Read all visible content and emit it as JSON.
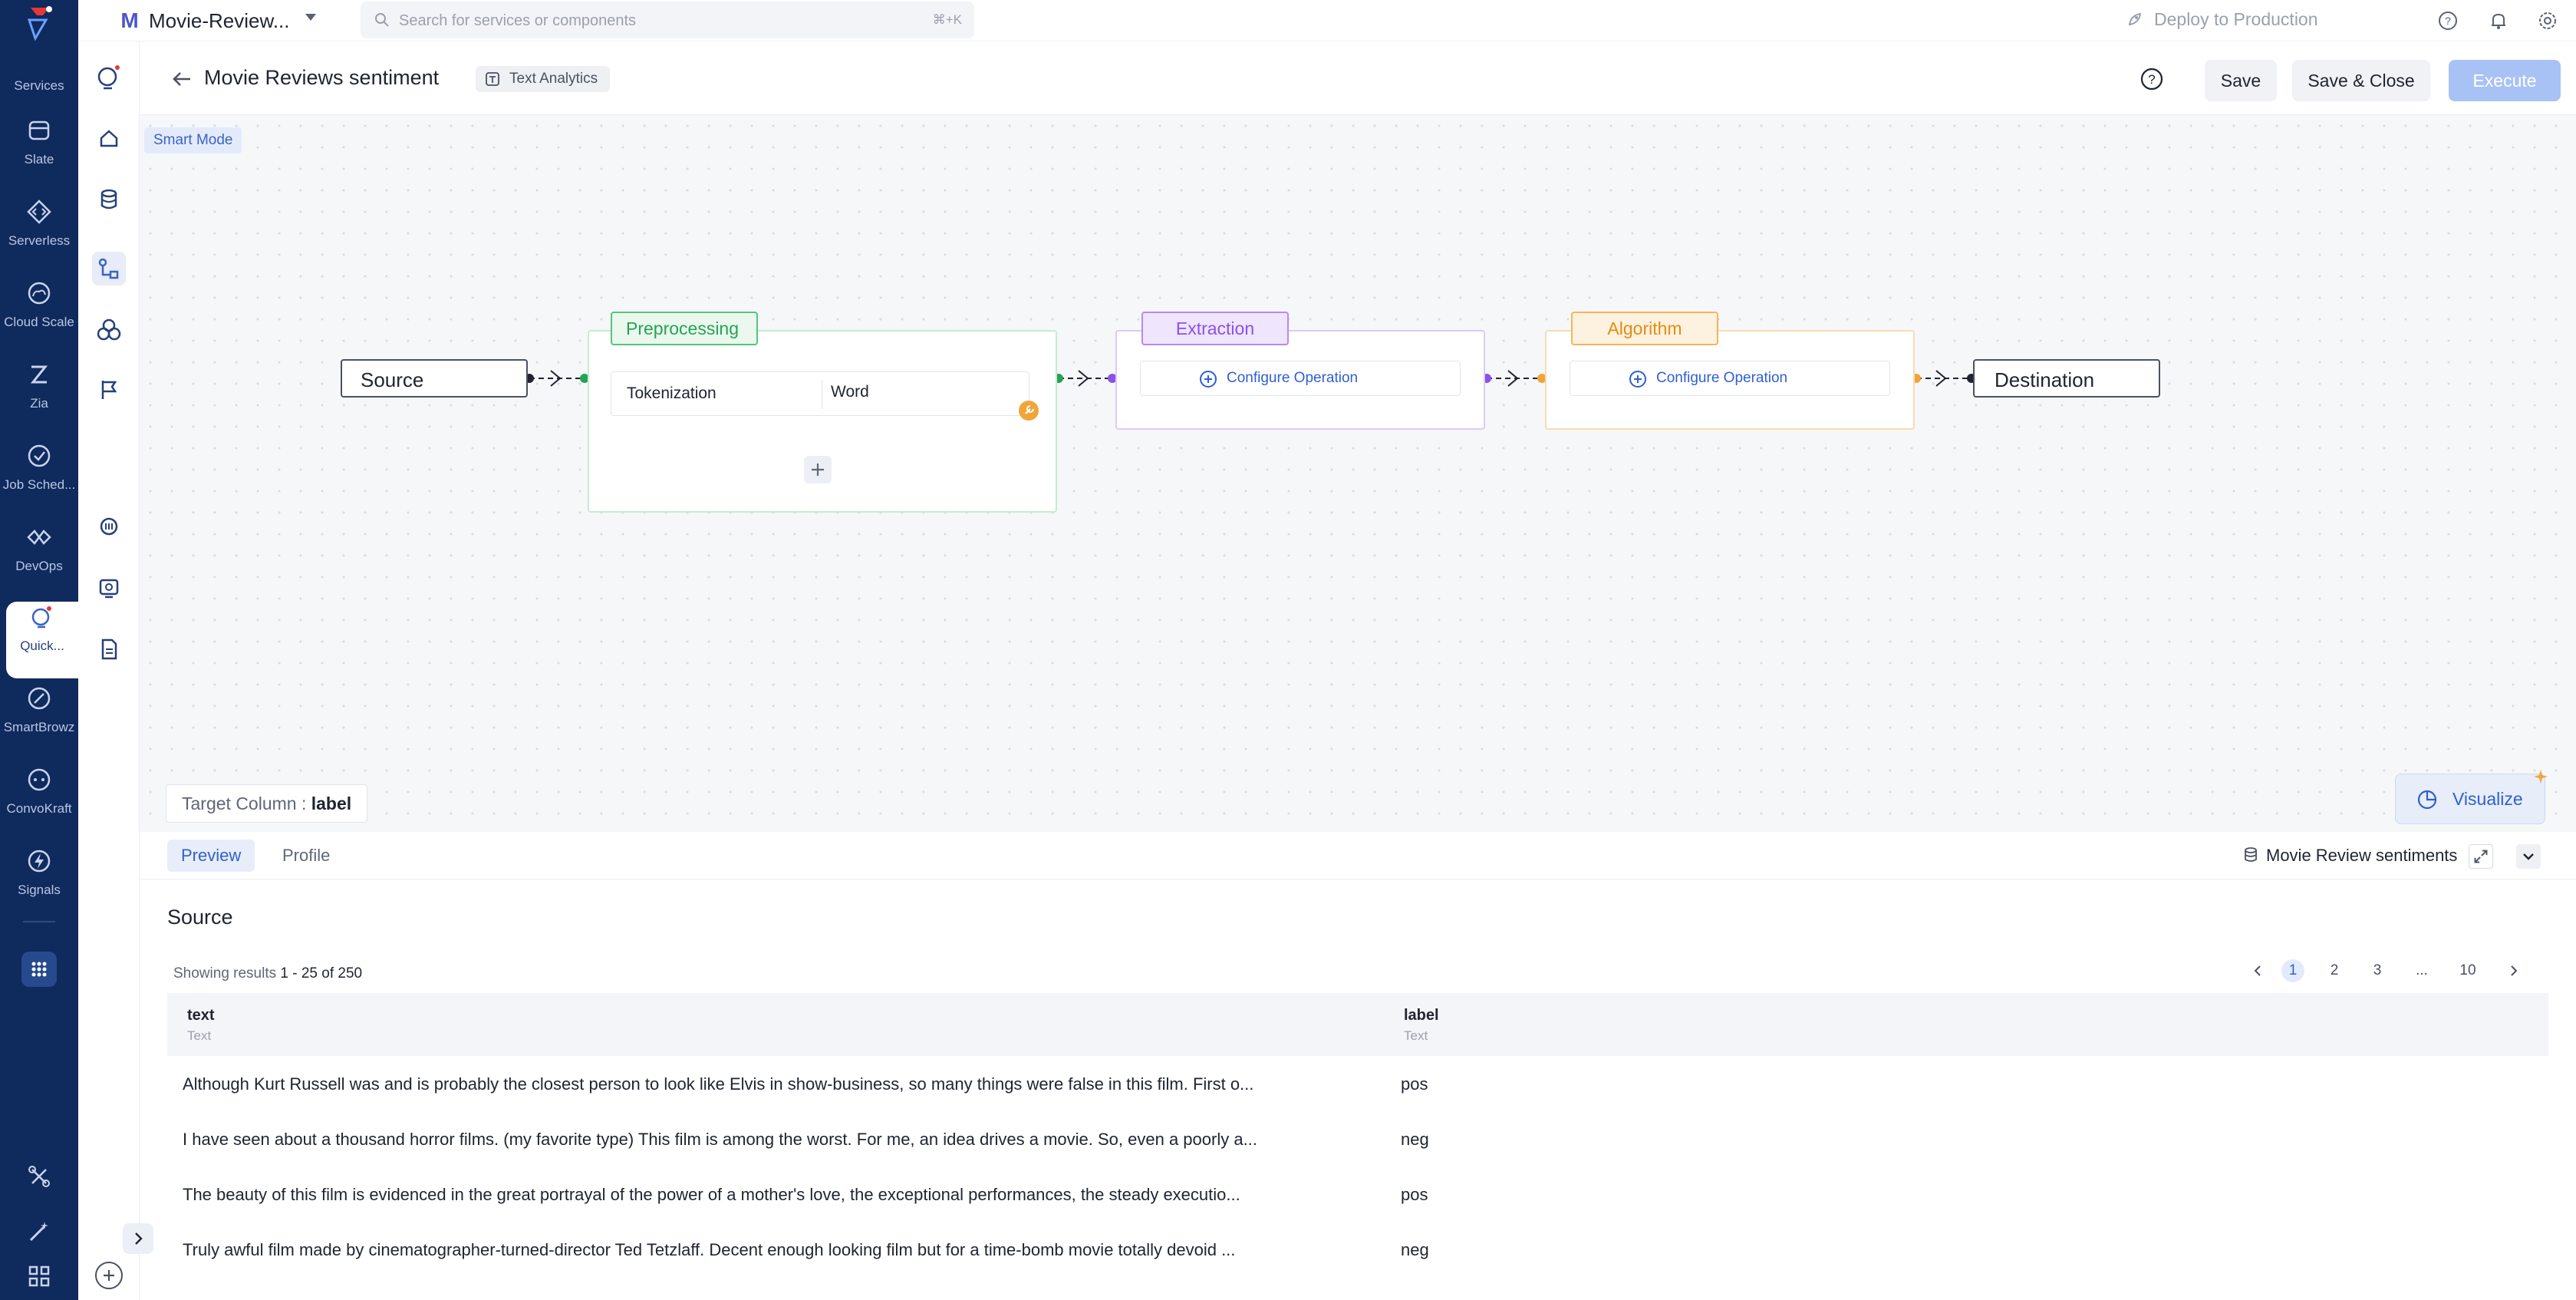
{
  "rail": {
    "top_label": "Services",
    "items": [
      {
        "label": "Slate",
        "icon": "slate-icon"
      },
      {
        "label": "Serverless",
        "icon": "serverless-icon"
      },
      {
        "label": "Cloud Scale",
        "icon": "cloud-scale-icon"
      },
      {
        "label": "Zia",
        "icon": "zia-icon"
      },
      {
        "label": "Job Sched...",
        "icon": "job-scheduler-icon"
      },
      {
        "label": "DevOps",
        "icon": "devops-icon"
      },
      {
        "label": "Quick...",
        "icon": "quickml-icon"
      },
      {
        "label": "SmartBrowz",
        "icon": "smartbrowz-icon"
      },
      {
        "label": "ConvoKraft",
        "icon": "convokraft-icon"
      },
      {
        "label": "Signals",
        "icon": "signals-icon"
      }
    ]
  },
  "topbar": {
    "project_initial": "M",
    "project_name": "Movie-Review...",
    "search_placeholder": "Search for services or components",
    "search_shortcut": "⌘+K",
    "deploy_label": "Deploy to Production"
  },
  "header": {
    "title": "Movie Reviews sentiment",
    "chip": "Text Analytics",
    "save": "Save",
    "save_close": "Save & Close",
    "execute": "Execute"
  },
  "canvas": {
    "mode": "Smart Mode",
    "source": "Source",
    "destination": "Destination",
    "stages": {
      "preprocessing": {
        "label": "Preprocessing",
        "color": "#25a353",
        "op_name": "Tokenization",
        "op_value": "Word"
      },
      "extraction": {
        "label": "Extraction",
        "color": "#8a52e6",
        "configure": "Configure Operation"
      },
      "algorithm": {
        "label": "Algorithm",
        "color": "#e38d12",
        "configure": "Configure Operation"
      }
    },
    "target_label": "Target Column : ",
    "target_value": "label",
    "visualize": "Visualize"
  },
  "panel": {
    "tabs": {
      "preview": "Preview",
      "profile": "Profile"
    },
    "dataset": "Movie Review sentiments",
    "section": "Source",
    "showing_prefix": "Showing results ",
    "showing_range": "1 - 25 of 250",
    "pages": [
      "1",
      "2",
      "3",
      "...",
      "10"
    ],
    "columns": [
      {
        "name": "text",
        "type": "Text"
      },
      {
        "name": "label",
        "type": "Text"
      }
    ],
    "rows": [
      {
        "text": "Although Kurt Russell was and is probably the closest person to look like Elvis in show-business, so many things were false in this film. First o...",
        "label": "pos"
      },
      {
        "text": "I have seen about a thousand horror films. (my favorite type) This film is among the worst. For me, an idea drives a movie. So, even a poorly a...",
        "label": "neg"
      },
      {
        "text": "The beauty of this film is evidenced in the great portrayal of the power of a mother's love, the exceptional performances, the steady executio...",
        "label": "pos"
      },
      {
        "text": "Truly awful film made by cinematographer-turned-director Ted Tetzlaff. Decent enough looking film but for a time-bomb movie totally devoid ...",
        "label": "neg"
      }
    ]
  }
}
